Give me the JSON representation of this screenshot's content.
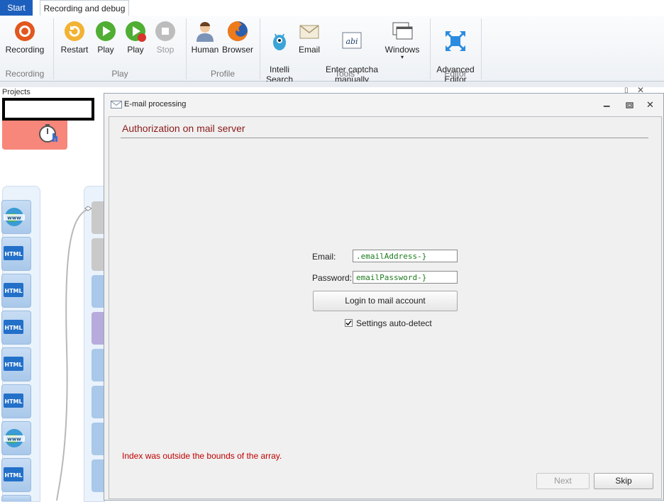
{
  "tabs": {
    "start": "Start",
    "recording_debug": "Recording and debug"
  },
  "ribbon": {
    "recording_group": {
      "label": "Recording",
      "buttons": [
        {
          "label": "Recording"
        }
      ]
    },
    "play_group": {
      "label": "Play",
      "buttons": [
        {
          "label": "Restart"
        },
        {
          "label": "Play"
        },
        {
          "label": "Play"
        },
        {
          "label": "Stop"
        }
      ]
    },
    "profile_group": {
      "label": "Profile",
      "buttons": [
        {
          "label": "Human"
        },
        {
          "label": "Browser"
        }
      ]
    },
    "tools_group": {
      "label": "Tools",
      "buttons": [
        {
          "label": "Intelli\nSearch"
        },
        {
          "label": "Email"
        },
        {
          "label": "Enter captcha\nmanually"
        },
        {
          "label": "Windows"
        }
      ]
    },
    "editor_group": {
      "label": "Editor",
      "buttons": [
        {
          "label": "Advanced\nEditor"
        }
      ]
    }
  },
  "projects_panel": {
    "title": "Projects",
    "pin_icon": "pin-icon",
    "close_icon": "close-icon"
  },
  "dialog": {
    "title": "E-mail processing",
    "heading": "Authorization on mail server",
    "email_label": "Email:",
    "email_value": ".emailAddress-}",
    "password_label": "Password:",
    "password_value": "emailPassword-}",
    "login_button": "Login to mail account",
    "autodetect_label": "Settings auto-detect",
    "autodetect_checked": true,
    "error_text": "Index was outside the bounds of the array.",
    "next_button": "Next",
    "skip_button": "Skip"
  },
  "colors": {
    "accent_tab": "#1d5fbd",
    "heading": "#8b1a1a",
    "error": "#c00000",
    "field_text": "#1d7a1d"
  }
}
